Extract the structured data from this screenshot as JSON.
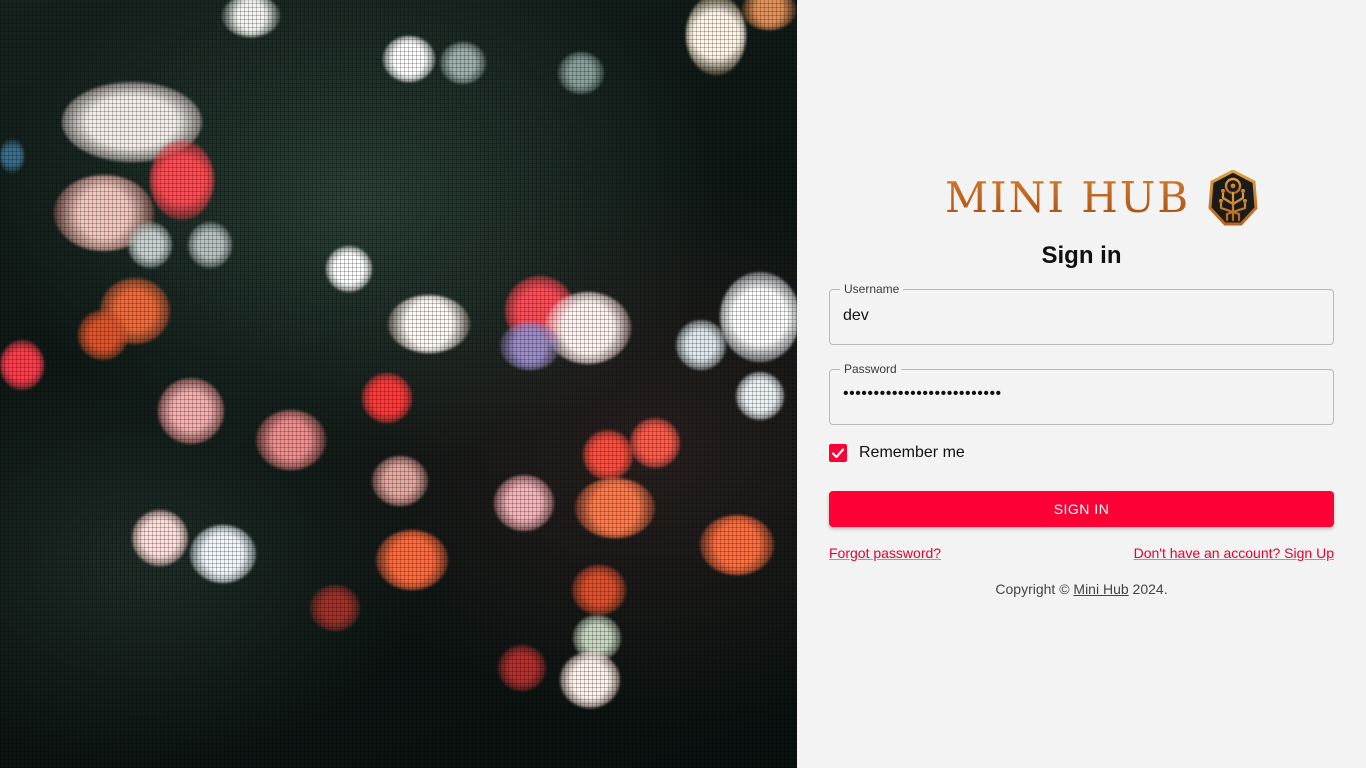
{
  "brand": {
    "name": "MINI HUB",
    "logo_icon": "circuit-tree-shield-icon",
    "accent": "#ff0036",
    "logo_color": "#b8621d"
  },
  "form": {
    "title": "Sign in",
    "username": {
      "label": "Username",
      "value": "dev"
    },
    "password": {
      "label": "Password",
      "value": "••••••••••••••••••••••••••"
    },
    "remember": {
      "label": "Remember me",
      "checked": true
    },
    "submit_label": "SIGN IN",
    "forgot_link": "Forgot password?",
    "signup_link": "Don't have an account? Sign Up"
  },
  "footer": {
    "prefix": "Copyright ©",
    "brand_link": "Mini Hub",
    "suffix": "2024."
  }
}
